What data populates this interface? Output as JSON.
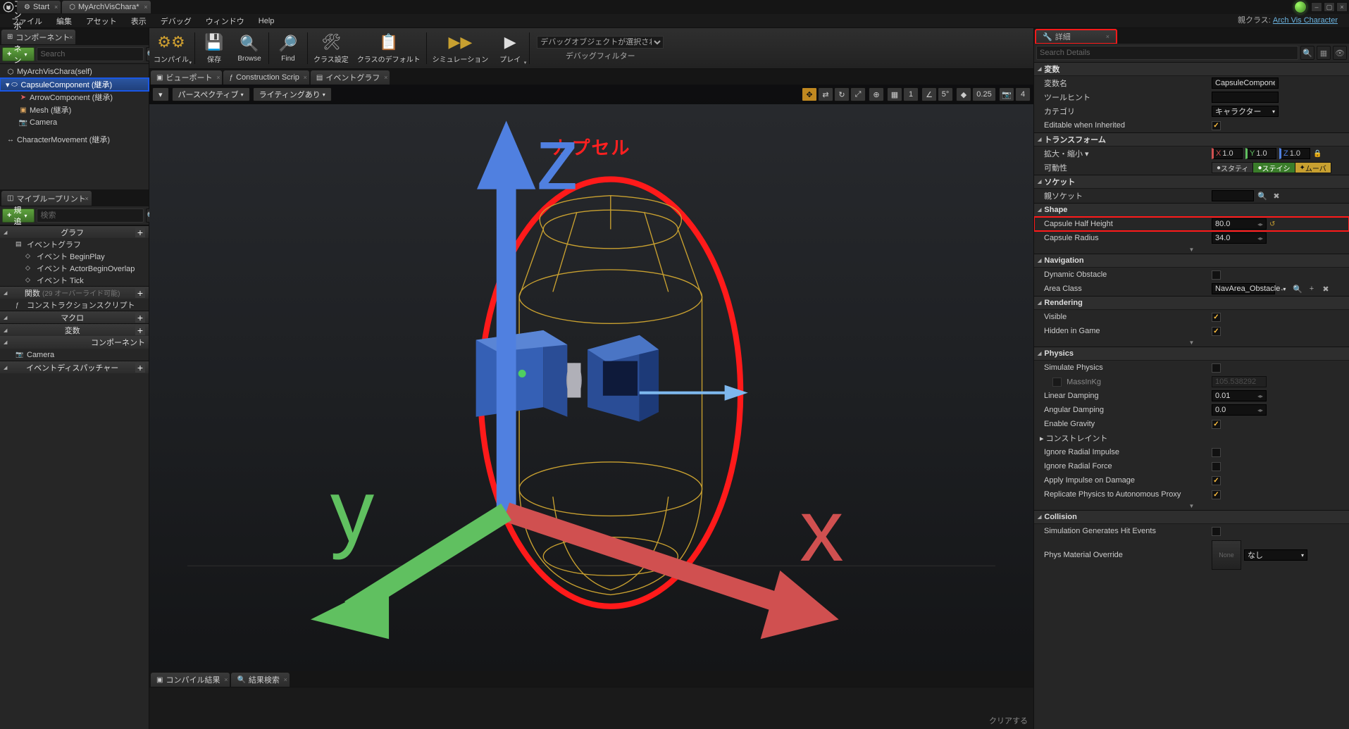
{
  "titlebar": {
    "tabs": [
      {
        "label": "Start",
        "icon": "⚙"
      },
      {
        "label": "MyArchVisChara*",
        "icon": "⬡"
      }
    ],
    "parent_class_label": "親クラス:",
    "parent_class_link": "Arch Vis Character"
  },
  "menubar": [
    "ファイル",
    "編集",
    "アセット",
    "表示",
    "デバッグ",
    "ウィンドウ",
    "Help"
  ],
  "components": {
    "tab_label": "コンポーネント",
    "add_label": "コンポーネントを追加",
    "search_placeholder": "Search",
    "items": [
      {
        "label": "MyArchVisChara(self)",
        "indent": 0,
        "icon": "⬡"
      },
      {
        "label": "CapsuleComponent (継承)",
        "indent": 0,
        "icon": "⬭",
        "selected": true
      },
      {
        "label": "ArrowComponent (継承)",
        "indent": 1,
        "icon": "➤"
      },
      {
        "label": "Mesh (継承)",
        "indent": 1,
        "icon": "▣"
      },
      {
        "label": "Camera",
        "indent": 1,
        "icon": "📷"
      },
      {
        "label": "CharacterMovement (継承)",
        "indent": 0,
        "icon": "↔"
      }
    ]
  },
  "myblueprint": {
    "tab_label": "マイブループリント",
    "add_label": "新規追加",
    "search_placeholder": "検索",
    "sections": {
      "graph": {
        "label": "グラフ",
        "items": [
          "イベントグラフ"
        ],
        "subitems": [
          "イベント BeginPlay",
          "イベント ActorBeginOverlap",
          "イベント Tick"
        ]
      },
      "functions": {
        "label": "関数",
        "hint": "(29 オーバーライド可能)",
        "items": [
          "コンストラクションスクリプト"
        ]
      },
      "macros": {
        "label": "マクロ"
      },
      "variables": {
        "label": "変数"
      },
      "components_sec": {
        "label": "コンポーネント",
        "items": [
          "Camera"
        ]
      },
      "dispatchers": {
        "label": "イベントディスパッチャー"
      }
    }
  },
  "toolbar": {
    "compile": "コンパイル",
    "save": "保存",
    "browse": "Browse",
    "find": "Find",
    "class_settings": "クラス設定",
    "class_defaults": "クラスのデフォルト",
    "simulation": "シミュレーション",
    "play": "プレイ",
    "debug_object": "デバッグオブジェクトが選択されていません",
    "debug_filter": "デバッグフィルター"
  },
  "center_tabs": [
    {
      "label": "ビューポート",
      "icon": "▣"
    },
    {
      "label": "Construction Scrip",
      "icon": "ƒ"
    },
    {
      "label": "イベントグラフ",
      "icon": "▤"
    }
  ],
  "viewport_bar": {
    "menu": "▾",
    "perspective": "パースペクティブ",
    "lighting": "ライティングあり",
    "snap_angle": "5°",
    "snap_val": "0.25",
    "cam_speed": "4",
    "grid1": "1",
    "capsule_label": "カプセル"
  },
  "results": {
    "compile_tab": "コンパイル結果",
    "search_tab": "結果検索",
    "clear": "クリアする"
  },
  "details": {
    "tab_label": "詳細",
    "search_placeholder": "Search Details",
    "cat_variable": "変数",
    "var_name_label": "変数名",
    "var_name_value": "CapsuleComponent",
    "tool_hint_label": "ツールヒント",
    "category_label": "カテゴリ",
    "category_value": "キャラクター",
    "editable_label": "Editable when Inherited",
    "cat_transform": "トランスフォーム",
    "scale_label": "拡大・縮小 ▾",
    "scale_x": "1.0",
    "scale_y": "1.0",
    "scale_z": "1.0",
    "mobility_label": "可動性",
    "mob_static": "スタティ",
    "mob_station": "ステイシ",
    "mob_movable": "ムーバ",
    "cat_sockets": "ソケット",
    "parent_socket_label": "親ソケット",
    "cat_shape": "Shape",
    "half_height_label": "Capsule Half Height",
    "half_height_value": "80.0",
    "radius_label": "Capsule Radius",
    "radius_value": "34.0",
    "cat_navigation": "Navigation",
    "dynamic_obs_label": "Dynamic Obstacle",
    "area_class_label": "Area Class",
    "area_class_value": "NavArea_Obstacle",
    "cat_rendering": "Rendering",
    "visible_label": "Visible",
    "hidden_label": "Hidden in Game",
    "cat_physics": "Physics",
    "sim_phys_label": "Simulate Physics",
    "mass_label": "MassInKg",
    "mass_value": "105.538292",
    "lin_damp_label": "Linear Damping",
    "lin_damp_value": "0.01",
    "ang_damp_label": "Angular Damping",
    "ang_damp_value": "0.0",
    "grav_label": "Enable Gravity",
    "constraints_label": "コンストレイント",
    "ign_rad_imp_label": "Ignore Radial Impulse",
    "ign_rad_force_label": "Ignore Radial Force",
    "apply_imp_label": "Apply Impulse on Damage",
    "replicate_label": "Replicate Physics to Autonomous Proxy",
    "cat_collision": "Collision",
    "sim_hit_label": "Simulation Generates Hit Events",
    "phys_mat_label": "Phys Material Override",
    "phys_mat_value": "None",
    "none_text": "なし"
  }
}
